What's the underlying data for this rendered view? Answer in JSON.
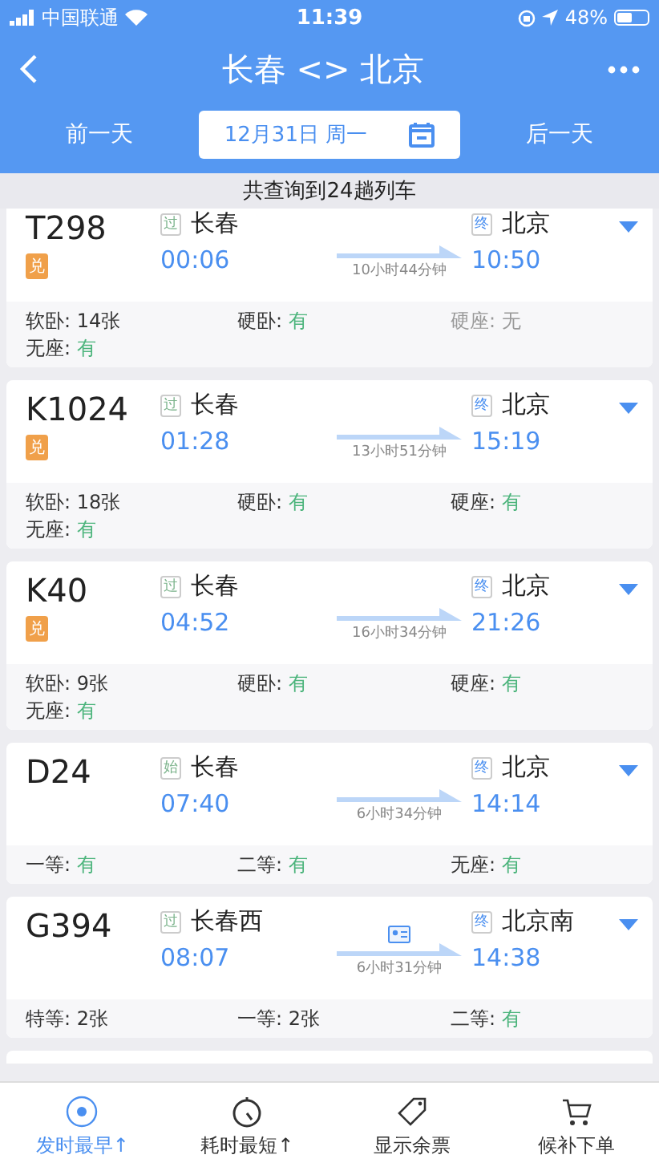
{
  "status_bar": {
    "carrier": "中国联通",
    "time": "11:39",
    "battery": "48%"
  },
  "nav": {
    "title": "长春 <> 北京"
  },
  "date_bar": {
    "prev": "前一天",
    "date": "12月31日 周一",
    "next": "后一天"
  },
  "summary": "共查询到24趟列车",
  "trains": [
    {
      "number": "T298",
      "exchange": true,
      "exchange_label": "兑",
      "from_tag": "过",
      "from": "长春",
      "depart": "00:06",
      "duration": "10小时44分钟",
      "id_icon": false,
      "to_tag": "终",
      "to": "北京",
      "arrive": "10:50",
      "seats": [
        {
          "label": "软卧: ",
          "value": "14张",
          "kind": "count"
        },
        {
          "label": "硬卧: ",
          "value": "有",
          "kind": "plenty"
        },
        {
          "label": "硬座: ",
          "value": "无",
          "kind": "none"
        },
        {
          "label": "无座: ",
          "value": "有",
          "kind": "plenty"
        }
      ]
    },
    {
      "number": "K1024",
      "exchange": true,
      "exchange_label": "兑",
      "from_tag": "过",
      "from": "长春",
      "depart": "01:28",
      "duration": "13小时51分钟",
      "id_icon": false,
      "to_tag": "终",
      "to": "北京",
      "arrive": "15:19",
      "seats": [
        {
          "label": "软卧: ",
          "value": "18张",
          "kind": "count"
        },
        {
          "label": "硬卧: ",
          "value": "有",
          "kind": "plenty"
        },
        {
          "label": "硬座: ",
          "value": "有",
          "kind": "plenty"
        },
        {
          "label": "无座: ",
          "value": "有",
          "kind": "plenty"
        }
      ]
    },
    {
      "number": "K40",
      "exchange": true,
      "exchange_label": "兑",
      "from_tag": "过",
      "from": "长春",
      "depart": "04:52",
      "duration": "16小时34分钟",
      "id_icon": false,
      "to_tag": "终",
      "to": "北京",
      "arrive": "21:26",
      "seats": [
        {
          "label": "软卧: ",
          "value": "9张",
          "kind": "count"
        },
        {
          "label": "硬卧: ",
          "value": "有",
          "kind": "plenty"
        },
        {
          "label": "硬座: ",
          "value": "有",
          "kind": "plenty"
        },
        {
          "label": "无座: ",
          "value": "有",
          "kind": "plenty"
        }
      ]
    },
    {
      "number": "D24",
      "exchange": false,
      "from_tag": "始",
      "from": "长春",
      "depart": "07:40",
      "duration": "6小时34分钟",
      "id_icon": false,
      "to_tag": "终",
      "to": "北京",
      "arrive": "14:14",
      "seats": [
        {
          "label": "一等: ",
          "value": "有",
          "kind": "plenty"
        },
        {
          "label": "二等: ",
          "value": "有",
          "kind": "plenty"
        },
        {
          "label": "无座: ",
          "value": "有",
          "kind": "plenty"
        }
      ]
    },
    {
      "number": "G394",
      "exchange": false,
      "from_tag": "过",
      "from": "长春西",
      "depart": "08:07",
      "duration": "6小时31分钟",
      "id_icon": true,
      "to_tag": "终",
      "to": "北京南",
      "arrive": "14:38",
      "seats": [
        {
          "label": "特等: ",
          "value": "2张",
          "kind": "count"
        },
        {
          "label": "一等: ",
          "value": "2张",
          "kind": "count"
        },
        {
          "label": "二等: ",
          "value": "有",
          "kind": "plenty"
        }
      ]
    }
  ],
  "tabs": [
    {
      "kind": "clock24",
      "label": "发时最早↑",
      "selected": true
    },
    {
      "kind": "timer",
      "label": "耗时最短↑",
      "selected": false
    },
    {
      "kind": "tag",
      "label": "显示余票",
      "selected": false
    },
    {
      "kind": "cart",
      "label": "候补下单",
      "selected": false
    }
  ]
}
